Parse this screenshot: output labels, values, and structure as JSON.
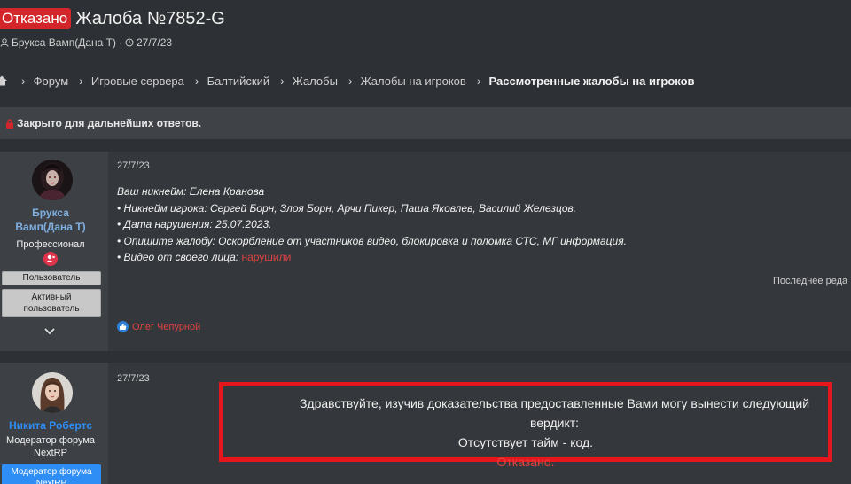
{
  "header": {
    "status": "Отказано",
    "title": "Жалоба №7852-G",
    "author": "Брукса Вамп(Дана Т)",
    "date": "27/7/23"
  },
  "breadcrumbs": [
    "Форум",
    "Игровые сервера",
    "Балтийский",
    "Жалобы",
    "Жалобы на игроков",
    "Рассмотренные жалобы на игроков"
  ],
  "notice": "Закрыто для дальнейших ответов.",
  "posts": [
    {
      "username_line1": "Брукса",
      "username_line2": "Вамп(Дана Т)",
      "user_title": "Профессионал",
      "badges": [
        "Пользователь",
        "Активный пользователь"
      ],
      "date": "27/7/23",
      "lines": [
        "Ваш никнейм: Елена Кранова",
        "• Никнейм игрока: Сергей Борн, Злоя Борн, Арчи Пикер, Паша Яковлев, Василий Железцов.",
        "• Дата нарушения: 25.07.2023.",
        "• Опишите жалобу: Оскорбление от участников видео, блокировка и поломка СТС, МГ информация."
      ],
      "video_label": "• Видео от своего лица: ",
      "video_link": "нарушили",
      "last_edit": "Последнее реда",
      "reaction_user": "Олег Чепурной"
    },
    {
      "username": "Никита Робертс",
      "user_title_line1": "Модератор форума",
      "user_title_line2": "NextRP",
      "badge": "Модератор форума NextRP",
      "date": "27/7/23",
      "verdict_line1": "Здравствуйте, изучив доказательства предоставленные Вами могу вынести следующий вердикт:",
      "verdict_line2": "Отсутствует тайм - код.",
      "verdict_line3": "Отказано."
    }
  ],
  "colors": {
    "status_badge": "#d3262a",
    "username_post1": "#7fb0e0",
    "username_post2": "#2f8ef5",
    "verdict_border": "#e6161c",
    "red_text": "#e04343"
  }
}
